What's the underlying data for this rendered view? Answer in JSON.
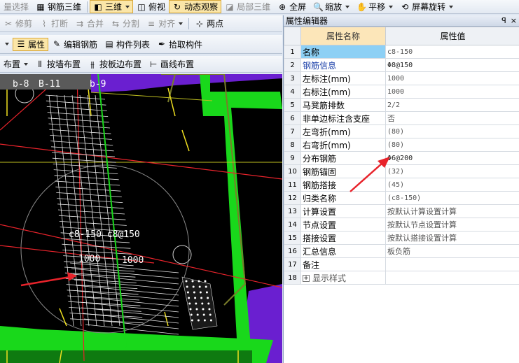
{
  "toolbar_top": {
    "select_label": "量选择",
    "rebar3d_label": "钢筋三维",
    "view3d_label": "三维",
    "topview_label": "俯视",
    "dynamic_label": "动态观察",
    "local3d_label": "局部三维",
    "fullscreen_label": "全屏",
    "zoom_label": "缩放",
    "pan_label": "平移",
    "rotate_label": "屏幕旋转"
  },
  "toolbar_edit": {
    "trim_label": "修剪",
    "break_label": "打断",
    "merge_label": "合并",
    "split_label": "分割",
    "align_label": "对齐",
    "twopoint_label": "两点"
  },
  "toolbar_prop": {
    "property_label": "属性",
    "edit_rebar_label": "编辑钢筋",
    "component_list_label": "构件列表",
    "pick_component_label": "拾取构件"
  },
  "toolbar_layout": {
    "layout_label": "布置",
    "by_wall_label": "按墙布置",
    "by_slab_edge_label": "按板边布置",
    "draw_line_label": "画线布置"
  },
  "viewport": {
    "axis_labels": [
      "b-8",
      "B-11",
      "b-9"
    ],
    "rebar_label": "c8-150 c8@150",
    "dim_left": "1000",
    "dim_right": "1000"
  },
  "panel": {
    "title": "属性编辑器",
    "pin": "ꟼ",
    "close": "×",
    "header_name": "属性名称",
    "header_value": "属性值",
    "rows": [
      {
        "n": "1",
        "name": "名称",
        "value": "c8-150"
      },
      {
        "n": "2",
        "name": "钢筋信息",
        "value": "Φ8@150"
      },
      {
        "n": "3",
        "name": "左标注(mm)",
        "value": "1000"
      },
      {
        "n": "4",
        "name": "右标注(mm)",
        "value": "1000"
      },
      {
        "n": "5",
        "name": "马凳筋排数",
        "value": "2/2"
      },
      {
        "n": "6",
        "name": "非单边标注含支座",
        "value": "否"
      },
      {
        "n": "7",
        "name": "左弯折(mm)",
        "value": "(80)"
      },
      {
        "n": "8",
        "name": "右弯折(mm)",
        "value": "(80)"
      },
      {
        "n": "9",
        "name": "分布钢筋",
        "value": "Φ6@200"
      },
      {
        "n": "10",
        "name": "钢筋锚固",
        "value": "(32)"
      },
      {
        "n": "11",
        "name": "钢筋搭接",
        "value": "(45)"
      },
      {
        "n": "12",
        "name": "归类名称",
        "value": "(c8-150)"
      },
      {
        "n": "13",
        "name": "计算设置",
        "value": "按默认计算设置计算"
      },
      {
        "n": "14",
        "name": "节点设置",
        "value": "按默认节点设置计算"
      },
      {
        "n": "15",
        "name": "搭接设置",
        "value": "按默认搭接设置计算"
      },
      {
        "n": "16",
        "name": "汇总信息",
        "value": "板负筋"
      },
      {
        "n": "17",
        "name": "备注",
        "value": ""
      },
      {
        "n": "18",
        "name": "显示样式",
        "value": ""
      }
    ]
  },
  "colors": {
    "annotation_arrow": "#e8232b",
    "beam_green": "#19d81b",
    "wall_purple": "#6a1fd0",
    "rebar_white": "#e8e8e8",
    "selected_row": "#8dd0f5"
  }
}
